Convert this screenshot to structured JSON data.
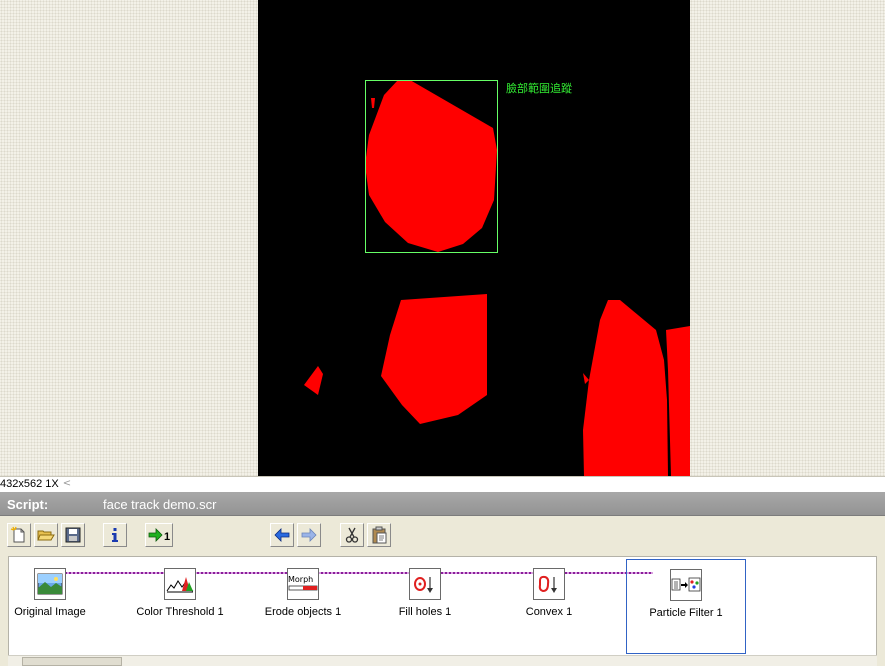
{
  "viewer": {
    "overlay_label": "臉部範圍追蹤",
    "image_info": "432x562 1X",
    "scroll_left_glyph": "<",
    "colors": {
      "background": "#000000",
      "blob": "#ff0000",
      "roi_box": "#66ff66"
    }
  },
  "script": {
    "label": "Script:",
    "filename": "face track demo.scr"
  },
  "toolbar": {
    "buttons": [
      {
        "name": "new-script-button",
        "icon": "new-document-icon"
      },
      {
        "name": "open-script-button",
        "icon": "folder-open-icon"
      },
      {
        "name": "save-script-button",
        "icon": "floppy-disk-icon"
      },
      {
        "name": "info-button",
        "icon": "info-icon"
      },
      {
        "name": "run-once-button",
        "icon": "arrow-run-once-icon",
        "text": "1"
      },
      {
        "name": "step-back-button",
        "icon": "arrow-left-icon"
      },
      {
        "name": "step-forward-button",
        "icon": "arrow-right-icon"
      },
      {
        "name": "cut-button",
        "icon": "scissors-icon"
      },
      {
        "name": "paste-button",
        "icon": "clipboard-icon"
      }
    ]
  },
  "steps": [
    {
      "label": "Original Image",
      "icon": "image-icon"
    },
    {
      "label": "Color Threshold 1",
      "icon": "histogram-icon"
    },
    {
      "label": "Erode objects 1",
      "icon": "morph-icon",
      "icon_text": "Morph"
    },
    {
      "label": "Fill holes 1",
      "icon": "fill-holes-icon"
    },
    {
      "label": "Convex 1",
      "icon": "convex-icon"
    },
    {
      "label": "Particle Filter 1",
      "icon": "particle-filter-icon",
      "selected": true
    }
  ]
}
